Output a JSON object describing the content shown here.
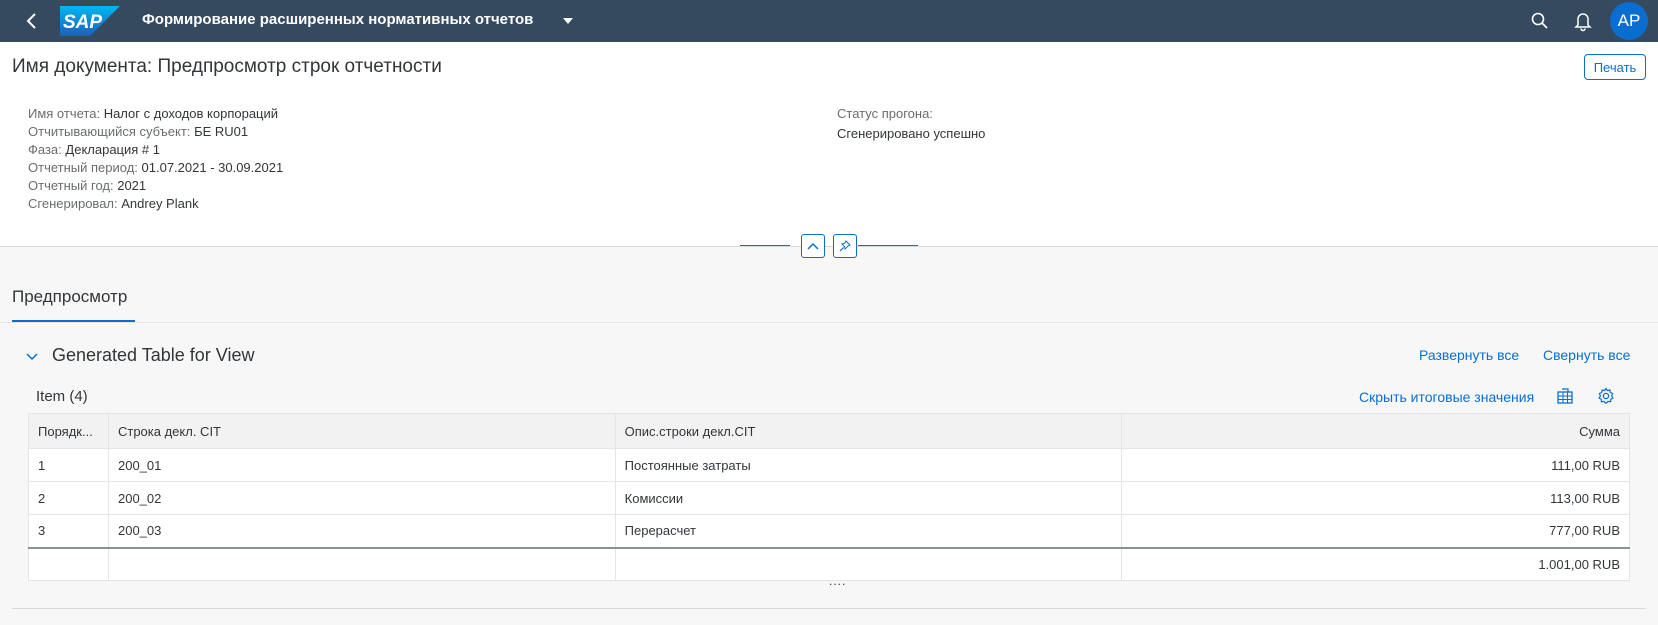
{
  "shell": {
    "logo_text": "SAP",
    "app_title": "Формирование расширенных нормативных отчетов",
    "avatar_initials": "AP",
    "brand_color": "#354a5f",
    "accent_color": "#0a6ed1"
  },
  "header": {
    "title": "Имя документа: Предпросмотр строк отчетности",
    "print_label": "Печать",
    "attributes": [
      {
        "label": "Имя отчета:",
        "value": "Налог с доходов корпораций"
      },
      {
        "label": "Отчитывающийся субъект:",
        "value": "БЕ RU01"
      },
      {
        "label": "Фаза:",
        "value": "Декларация # 1"
      },
      {
        "label": "Отчетный период:",
        "value": "01.07.2021 - 30.09.2021"
      },
      {
        "label": "Отчетный год:",
        "value": "2021"
      },
      {
        "label": "Сгенерировал:",
        "value": "Andrey Plank"
      }
    ],
    "status_label": "Статус прогона:",
    "status_value": "Сгенерировано успешно"
  },
  "tabs": [
    {
      "label": "Предпросмотр",
      "selected": true
    }
  ],
  "section": {
    "title": "Generated Table for View",
    "expand_all": "Развернуть все",
    "collapse_all": "Свернуть все"
  },
  "table": {
    "item_count": "Item (4)",
    "hide_totals": "Скрыть итоговые значения",
    "columns": [
      "Порядк...",
      "Строка декл. CIT",
      "Опис.строки декл.CIT",
      "Сумма"
    ],
    "rows": [
      [
        "1",
        "200_01",
        "Постоянные затраты",
        "111,00 RUB"
      ],
      [
        "2",
        "200_02",
        "Комиссии",
        "113,00 RUB"
      ],
      [
        "3",
        "200_03",
        "Перерасчет",
        "777,00 RUB"
      ]
    ],
    "total": "1.001,00 RUB",
    "more_indicator": "...."
  },
  "icons": [
    "back-icon",
    "search-icon",
    "bell-icon",
    "collapse-header-icon",
    "pin-icon",
    "chevron-down-icon",
    "export-icon",
    "settings-gear-icon"
  ]
}
